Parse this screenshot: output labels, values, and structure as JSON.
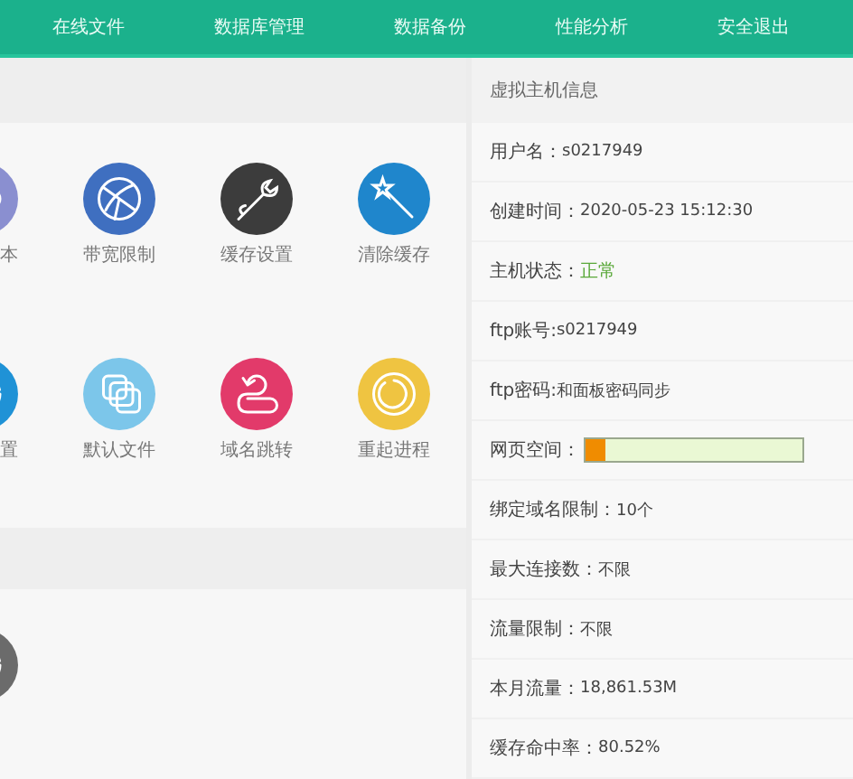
{
  "nav": [
    {
      "label": "在线文件"
    },
    {
      "label": "数据库管理"
    },
    {
      "label": "数据备份"
    },
    {
      "label": "性能分析"
    },
    {
      "label": "安全退出"
    }
  ],
  "tools": [
    {
      "label": "本"
    },
    {
      "label": "带宽限制"
    },
    {
      "label": "缓存设置"
    },
    {
      "label": "清除缓存"
    },
    {
      "label": "置"
    },
    {
      "label": "默认文件"
    },
    {
      "label": "域名跳转"
    },
    {
      "label": "重起进程"
    }
  ],
  "info": {
    "title": "虚拟主机信息",
    "rows": [
      {
        "kind": "text",
        "label": "用户名：",
        "value": "s0217949"
      },
      {
        "kind": "text",
        "label": "创建时间：",
        "value": "2020-05-23 15:12:30"
      },
      {
        "kind": "status",
        "label": "主机状态：",
        "value": "正常"
      },
      {
        "kind": "text",
        "label": "ftp账号:",
        "value": "s0217949"
      },
      {
        "kind": "text",
        "label": "ftp密码:",
        "value": "和面板密码同步"
      },
      {
        "kind": "meter",
        "label": "网页空间：",
        "level": 0.09
      },
      {
        "kind": "text",
        "label": "绑定域名限制：",
        "value": "10个"
      },
      {
        "kind": "text",
        "label": "最大连接数：",
        "value": "不限"
      },
      {
        "kind": "text",
        "label": "流量限制：",
        "value": "不限"
      },
      {
        "kind": "text",
        "label": "本月流量：",
        "value": "18,861.53M"
      },
      {
        "kind": "text",
        "label": "缓存命中率：",
        "value": "80.52%"
      }
    ]
  }
}
